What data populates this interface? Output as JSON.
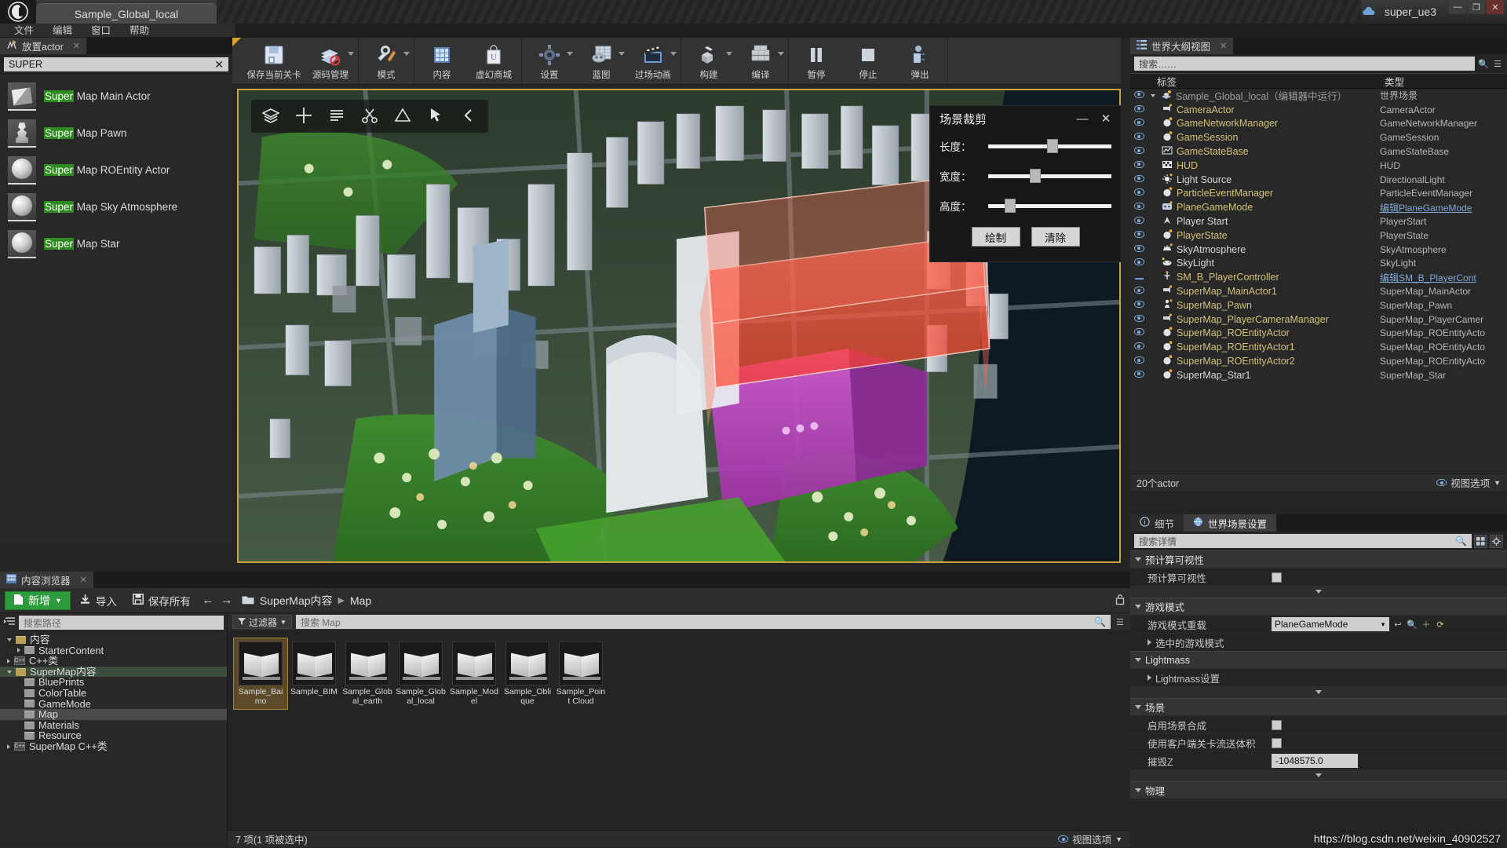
{
  "titlebar": {
    "project_tab": "Sample_Global_local",
    "user": "super_ue3",
    "minimize": "—",
    "maximize": "❐",
    "close": "✕",
    "cloud_icon": "cloud-icon"
  },
  "menubar": {
    "items": [
      "文件",
      "编辑",
      "窗口",
      "帮助"
    ]
  },
  "place_actor": {
    "tab_label": "放置actor",
    "search_value": "SUPER",
    "clear_label": "✕",
    "items": [
      {
        "highlight": "Super",
        "rest": " Map Main Actor",
        "thumb": "box"
      },
      {
        "highlight": "Super",
        "rest": " Map Pawn",
        "thumb": "pawn"
      },
      {
        "highlight": "Super",
        "rest": " Map ROEntity Actor",
        "thumb": "sphere"
      },
      {
        "highlight": "Super",
        "rest": " Map Sky Atmosphere",
        "thumb": "sphere"
      },
      {
        "highlight": "Super",
        "rest": " Map Star",
        "thumb": "sphere"
      }
    ]
  },
  "toolbar": {
    "groups": [
      {
        "buttons": [
          {
            "label": "保存当前关卡",
            "icon": "save-icon",
            "caret": false,
            "wide": true
          },
          {
            "label": "源码管理",
            "icon": "source-control-icon",
            "caret": true
          }
        ]
      },
      {
        "buttons": [
          {
            "label": "模式",
            "icon": "modes-icon",
            "caret": true
          }
        ]
      },
      {
        "buttons": [
          {
            "label": "内容",
            "icon": "content-icon",
            "caret": false
          },
          {
            "label": "虚幻商城",
            "icon": "marketplace-icon",
            "caret": false
          }
        ]
      },
      {
        "buttons": [
          {
            "label": "设置",
            "icon": "settings-icon",
            "caret": true
          },
          {
            "label": "蓝图",
            "icon": "blueprint-icon",
            "caret": true
          },
          {
            "label": "过场动画",
            "icon": "cinematics-icon",
            "caret": true
          }
        ]
      },
      {
        "buttons": [
          {
            "label": "构建",
            "icon": "build-icon",
            "caret": true
          },
          {
            "label": "编译",
            "icon": "compile-icon",
            "caret": true
          }
        ]
      },
      {
        "buttons": [
          {
            "label": "暂停",
            "icon": "pause-icon",
            "caret": false
          },
          {
            "label": "停止",
            "icon": "stop-icon",
            "caret": false
          },
          {
            "label": "弹出",
            "icon": "eject-icon",
            "caret": false
          }
        ]
      }
    ]
  },
  "viewport": {
    "tools": [
      "layers-icon",
      "move-icon",
      "list-icon",
      "scissors-icon",
      "measure-icon",
      "select-icon",
      "chevron-left-icon"
    ]
  },
  "clip_dialog": {
    "title": "场景裁剪",
    "minimize": "—",
    "close": "✕",
    "rows": [
      {
        "label": "长度：",
        "value": 52
      },
      {
        "label": "宽度：",
        "value": 38
      },
      {
        "label": "高度：",
        "value": 18
      }
    ],
    "draw_button": "绘制",
    "clear_button": "清除"
  },
  "outliner": {
    "tab_label": "世界大纲视图",
    "search_placeholder": "搜索……",
    "columns": [
      "标签",
      "类型"
    ],
    "rows": [
      {
        "name": "Sample_Global_local（编辑器中运行）",
        "type": "世界场景",
        "style": "root",
        "icon": "world-icon",
        "eye": true,
        "indent": 0
      },
      {
        "name": "CameraActor",
        "type": "CameraActor",
        "style": "gold",
        "icon": "camera-icon",
        "eye": true,
        "indent": 1
      },
      {
        "name": "GameNetworkManager",
        "type": "GameNetworkManager",
        "style": "gold",
        "icon": "sphere-icon",
        "eye": true,
        "indent": 1
      },
      {
        "name": "GameSession",
        "type": "GameSession",
        "style": "gold",
        "icon": "sphere-icon",
        "eye": true,
        "indent": 1
      },
      {
        "name": "GameStateBase",
        "type": "GameStateBase",
        "style": "gold",
        "icon": "graph-icon",
        "eye": true,
        "indent": 1
      },
      {
        "name": "HUD",
        "type": "HUD",
        "style": "gold",
        "icon": "hud-icon",
        "eye": true,
        "indent": 1
      },
      {
        "name": "Light Source",
        "type": "DirectionalLight",
        "style": "white",
        "icon": "light-icon",
        "eye": true,
        "indent": 1
      },
      {
        "name": "ParticleEventManager",
        "type": "ParticleEventManager",
        "style": "gold",
        "icon": "sphere-icon",
        "eye": true,
        "indent": 1
      },
      {
        "name": "PlaneGameMode",
        "type": "编辑PlaneGameMode",
        "type_link": true,
        "style": "gold",
        "icon": "gamemode-icon",
        "eye": true,
        "indent": 1
      },
      {
        "name": "Player Start",
        "type": "PlayerStart",
        "style": "white",
        "icon": "playerstart-icon",
        "eye": true,
        "indent": 1
      },
      {
        "name": "PlayerState",
        "type": "PlayerState",
        "style": "gold",
        "icon": "sphere-icon",
        "eye": true,
        "indent": 1
      },
      {
        "name": "SkyAtmosphere",
        "type": "SkyAtmosphere",
        "style": "white",
        "icon": "sky-icon",
        "eye": true,
        "indent": 1
      },
      {
        "name": "SkyLight",
        "type": "SkyLight",
        "style": "white",
        "icon": "skylight-icon",
        "eye": true,
        "indent": 1
      },
      {
        "name": "SM_B_PlayerController",
        "type": "编辑SM_B_PlayerCont",
        "type_link": true,
        "style": "gold",
        "icon": "controller-icon",
        "eye": false,
        "indent": 1
      },
      {
        "name": "SuperMap_MainActor1",
        "type": "SuperMap_MainActor",
        "style": "gold",
        "icon": "camera-icon",
        "eye": true,
        "indent": 1
      },
      {
        "name": "SuperMap_Pawn",
        "type": "SuperMap_Pawn",
        "style": "gold",
        "icon": "pawn-icon",
        "eye": true,
        "indent": 1
      },
      {
        "name": "SuperMap_PlayerCameraManager",
        "type": "SuperMap_PlayerCamer",
        "style": "gold",
        "icon": "camera-icon",
        "eye": true,
        "indent": 1
      },
      {
        "name": "SuperMap_ROEntityActor",
        "type": "SuperMap_ROEntityActo",
        "style": "gold",
        "icon": "sphere-icon",
        "eye": true,
        "indent": 1
      },
      {
        "name": "SuperMap_ROEntityActor1",
        "type": "SuperMap_ROEntityActo",
        "style": "gold",
        "icon": "sphere-icon",
        "eye": true,
        "indent": 1
      },
      {
        "name": "SuperMap_ROEntityActor2",
        "type": "SuperMap_ROEntityActo",
        "style": "gold",
        "icon": "sphere-icon",
        "eye": true,
        "indent": 1
      },
      {
        "name": "SuperMap_Star1",
        "type": "SuperMap_Star",
        "style": "white",
        "icon": "sphere-icon",
        "eye": true,
        "indent": 1
      }
    ],
    "footer_count": "20个actor",
    "footer_view_options": "视图选项"
  },
  "details": {
    "tabs": [
      {
        "label": "细节",
        "icon": "info-icon",
        "active": false
      },
      {
        "label": "世界场景设置",
        "icon": "world-settings-icon",
        "active": true
      }
    ],
    "search_placeholder": "搜索详情",
    "sections": [
      {
        "title": "预计算可视性",
        "rows": [
          {
            "label": "预计算可视性",
            "control": "checkbox",
            "value": ""
          }
        ],
        "has_expander": true
      },
      {
        "title": "游戏模式",
        "rows": [
          {
            "label": "游戏模式重载",
            "control": "combo",
            "value": "PlaneGameMode"
          },
          {
            "label": "选中的游戏模式",
            "control": "expand",
            "value": ""
          }
        ],
        "has_expander": false
      },
      {
        "title": "Lightmass",
        "rows": [
          {
            "label": "Lightmass设置",
            "control": "expand",
            "value": ""
          }
        ],
        "has_expander": true
      },
      {
        "title": "场景",
        "rows": [
          {
            "label": "启用场景合成",
            "control": "checkbox",
            "value": ""
          },
          {
            "label": "使用客户端关卡流送体积",
            "control": "checkbox",
            "value": ""
          },
          {
            "label": "摧毁Z",
            "control": "number",
            "value": "-1048575.0"
          }
        ],
        "has_expander": true
      },
      {
        "title": "物理",
        "rows": [],
        "has_expander": false
      }
    ]
  },
  "content_browser": {
    "tab_label": "内容浏览器",
    "new_button": "新增",
    "import_button": "导入",
    "save_all_button": "保存所有",
    "back_arrow": "←",
    "forward_arrow": "→",
    "breadcrumb": [
      "SuperMap内容",
      "Map"
    ],
    "path_search_placeholder": "搜索路径",
    "tree": [
      {
        "label": "内容",
        "depth": 0,
        "icon": "folder",
        "expanded": true,
        "selected": false
      },
      {
        "label": "StarterContent",
        "depth": 1,
        "icon": "folder-gray",
        "expanded": false,
        "selected": false
      },
      {
        "label": "C++类",
        "depth": 0,
        "icon": "cpp",
        "expanded": false,
        "selected": false
      },
      {
        "label": "SuperMap内容",
        "depth": 0,
        "icon": "folder",
        "expanded": true,
        "selected": false,
        "highlight": true
      },
      {
        "label": "BluePrints",
        "depth": 1,
        "icon": "folder-gray",
        "expanded": false,
        "selected": false
      },
      {
        "label": "ColorTable",
        "depth": 1,
        "icon": "folder-gray",
        "expanded": false,
        "selected": false
      },
      {
        "label": "GameMode",
        "depth": 1,
        "icon": "folder-gray",
        "expanded": false,
        "selected": false
      },
      {
        "label": "Map",
        "depth": 1,
        "icon": "folder-gray",
        "expanded": false,
        "selected": true
      },
      {
        "label": "Materials",
        "depth": 1,
        "icon": "folder-gray",
        "expanded": false,
        "selected": false
      },
      {
        "label": "Resource",
        "depth": 1,
        "icon": "folder-gray",
        "expanded": false,
        "selected": false
      },
      {
        "label": "SuperMap C++类",
        "depth": 0,
        "icon": "cpp",
        "expanded": false,
        "selected": false
      }
    ],
    "filter_button": "过滤器",
    "asset_search_placeholder": "搜索 Map",
    "assets": [
      {
        "name": "Sample_Baimo",
        "selected": true
      },
      {
        "name": "Sample_BIM",
        "selected": false
      },
      {
        "name": "Sample_Global_earth",
        "selected": false
      },
      {
        "name": "Sample_Global_local",
        "selected": false
      },
      {
        "name": "Sample_Model",
        "selected": false
      },
      {
        "name": "Sample_Oblique",
        "selected": false
      },
      {
        "name": "Sample_Point Cloud",
        "selected": false
      }
    ],
    "status_text": "7 项(1 项被选中)",
    "view_options": "视图选项"
  },
  "watermark": "https://blog.csdn.net/weixin_40902527",
  "colors": {
    "accent_green": "#2e9b3c",
    "viewport_border": "#c8a53c",
    "highlight_green": "#2e8b20",
    "link_blue": "#7fa8d6",
    "gold_text": "#d2c178"
  }
}
